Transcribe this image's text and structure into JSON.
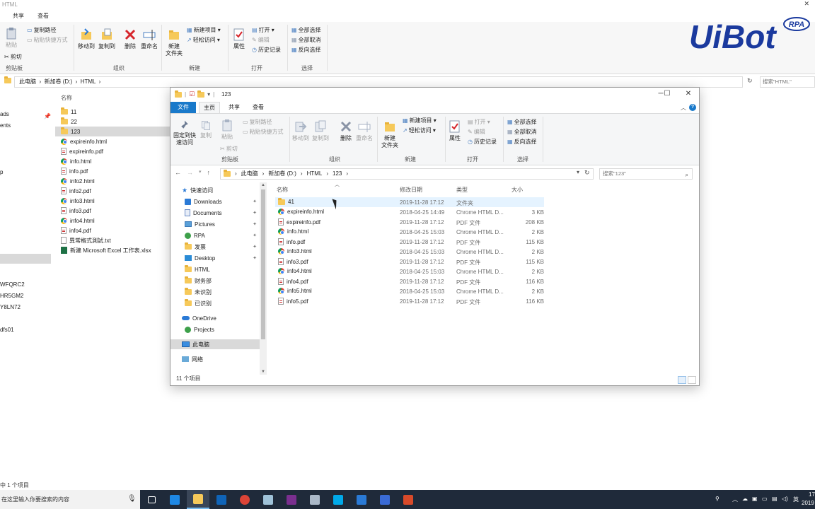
{
  "background": {
    "title": "HTML",
    "tabs": [
      "共享",
      "查看"
    ],
    "ribbon": {
      "clipboard": {
        "paste": "粘贴",
        "copy_path": "复制路径",
        "paste_shortcut": "粘贴快捷方式",
        "cut": "剪切",
        "label": "剪贴板"
      },
      "organize": {
        "move_to": "移动到",
        "copy_to": "复制到",
        "delete": "删除",
        "rename": "重命名",
        "label": "组织"
      },
      "new": {
        "new_folder": "新建\n文件夹",
        "new_item": "新建项目 ▾",
        "easy_access": "轻松访问 ▾",
        "label": "新建"
      },
      "open": {
        "properties": "属性",
        "open": "打开 ▾",
        "edit": "编辑",
        "history": "历史记录",
        "label": "打开"
      },
      "select": {
        "select_all": "全部选择",
        "select_none": "全部取消",
        "invert": "反向选择",
        "label": "选择"
      }
    },
    "address": [
      "此电脑",
      "新加卷 (D:)",
      "HTML"
    ],
    "search_placeholder": "搜索\"HTML\"",
    "left_nav": [
      "ads",
      "ents",
      "p",
      "WFQRC2",
      "HR5GM2",
      "Y8LN72",
      "dfs01"
    ],
    "column_name": "名称",
    "files": [
      {
        "name": "11",
        "icon": "folder"
      },
      {
        "name": "22",
        "icon": "folder"
      },
      {
        "name": "123",
        "icon": "folder"
      },
      {
        "name": "expireinfo.html",
        "icon": "chrome"
      },
      {
        "name": "expireinfo.pdf",
        "icon": "pdf"
      },
      {
        "name": "info.html",
        "icon": "chrome"
      },
      {
        "name": "info.pdf",
        "icon": "pdf"
      },
      {
        "name": "info2.html",
        "icon": "chrome"
      },
      {
        "name": "info2.pdf",
        "icon": "pdf"
      },
      {
        "name": "info3.html",
        "icon": "chrome"
      },
      {
        "name": "info3.pdf",
        "icon": "pdf"
      },
      {
        "name": "info4.html",
        "icon": "chrome"
      },
      {
        "name": "info4.pdf",
        "icon": "pdf"
      },
      {
        "name": "異常格式測試.txt",
        "icon": "txt"
      },
      {
        "name": "新建 Microsoft Excel 工作表.xlsx",
        "icon": "xls"
      }
    ],
    "status": "中 1 个项目"
  },
  "logo": {
    "text": "UiBot",
    "badge": "RPA"
  },
  "window": {
    "title": "123",
    "tabs": {
      "file": "文件",
      "home": "主页",
      "share": "共享",
      "view": "查看"
    },
    "ribbon": {
      "pin": "固定到快\n速访问",
      "copy": "复制",
      "paste": "粘贴",
      "copy_path": "复制路径",
      "paste_shortcut": "粘贴快捷方式",
      "cut": "剪切",
      "clipboard_label": "剪贴板",
      "move_to": "移动到",
      "copy_to": "复制到",
      "delete": "删除",
      "rename": "重命名",
      "organize_label": "组织",
      "new_folder": "新建\n文件夹",
      "new_item": "新建项目 ▾",
      "easy_access": "轻松访问 ▾",
      "new_label": "新建",
      "properties": "属性",
      "open": "打开 ▾",
      "edit": "编辑",
      "history": "历史记录",
      "open_label": "打开",
      "select_all": "全部选择",
      "select_none": "全部取消",
      "invert": "反向选择",
      "select_label": "选择"
    },
    "address": [
      "此电脑",
      "新加卷 (D:)",
      "HTML",
      "123"
    ],
    "search_placeholder": "搜索\"123\"",
    "nav": [
      {
        "label": "快速访问",
        "icon": "star",
        "pin": false
      },
      {
        "label": "Downloads",
        "icon": "download",
        "pin": true
      },
      {
        "label": "Documents",
        "icon": "doc",
        "pin": true
      },
      {
        "label": "Pictures",
        "icon": "pic",
        "pin": true
      },
      {
        "label": "RPA",
        "icon": "rpa",
        "pin": true
      },
      {
        "label": "发票",
        "icon": "folder",
        "pin": true
      },
      {
        "label": "Desktop",
        "icon": "desk",
        "pin": true
      },
      {
        "label": "HTML",
        "icon": "folder",
        "pin": false
      },
      {
        "label": "财务部",
        "icon": "folder",
        "pin": false
      },
      {
        "label": "未识别",
        "icon": "folder",
        "pin": false
      },
      {
        "label": "已识别",
        "icon": "folder",
        "pin": false
      },
      {
        "label": "OneDrive",
        "icon": "cloud",
        "pin": false
      },
      {
        "label": "Projects",
        "icon": "rpa",
        "pin": false
      },
      {
        "label": "此电脑",
        "icon": "pc",
        "pin": false
      },
      {
        "label": "网络",
        "icon": "net",
        "pin": false
      }
    ],
    "columns": {
      "name": "名称",
      "date": "修改日期",
      "type": "类型",
      "size": "大小"
    },
    "files": [
      {
        "name": "41",
        "date": "2019-11-28 17:12",
        "type": "文件夹",
        "size": "",
        "icon": "folder"
      },
      {
        "name": "expireinfo.html",
        "date": "2018-04-25 14:49",
        "type": "Chrome HTML D...",
        "size": "3 KB",
        "icon": "chrome"
      },
      {
        "name": "expireinfo.pdf",
        "date": "2019-11-28 17:12",
        "type": "PDF 文件",
        "size": "208 KB",
        "icon": "pdf"
      },
      {
        "name": "info.html",
        "date": "2018-04-25 15:03",
        "type": "Chrome HTML D...",
        "size": "2 KB",
        "icon": "chrome"
      },
      {
        "name": "info.pdf",
        "date": "2019-11-28 17:12",
        "type": "PDF 文件",
        "size": "115 KB",
        "icon": "pdf"
      },
      {
        "name": "info3.html",
        "date": "2018-04-25 15:03",
        "type": "Chrome HTML D...",
        "size": "2 KB",
        "icon": "chrome"
      },
      {
        "name": "info3.pdf",
        "date": "2019-11-28 17:12",
        "type": "PDF 文件",
        "size": "115 KB",
        "icon": "pdf"
      },
      {
        "name": "info4.html",
        "date": "2018-04-25 15:03",
        "type": "Chrome HTML D...",
        "size": "2 KB",
        "icon": "chrome"
      },
      {
        "name": "info4.pdf",
        "date": "2019-11-28 17:12",
        "type": "PDF 文件",
        "size": "116 KB",
        "icon": "pdf"
      },
      {
        "name": "info5.html",
        "date": "2018-04-25 15:03",
        "type": "Chrome HTML D...",
        "size": "2 KB",
        "icon": "chrome"
      },
      {
        "name": "info5.pdf",
        "date": "2019-11-28 17:12",
        "type": "PDF 文件",
        "size": "116 KB",
        "icon": "pdf"
      }
    ],
    "status": "11 个项目"
  },
  "taskbar": {
    "search_text": "在这里输入你要搜索的内容",
    "apps": [
      "task-view",
      "edge",
      "file-explorer",
      "outlook",
      "chrome",
      "notepad",
      "onenote",
      "app",
      "skype",
      "remote",
      "uibot",
      "app2"
    ],
    "tray": {
      "ime": "英",
      "clock_top": "17",
      "clock_bottom": "2019"
    }
  },
  "colors": {
    "accent": "#1979ca",
    "folder": "#f6c95a",
    "logo": "#1b3a9e",
    "taskbar": "#1f2a3a"
  }
}
